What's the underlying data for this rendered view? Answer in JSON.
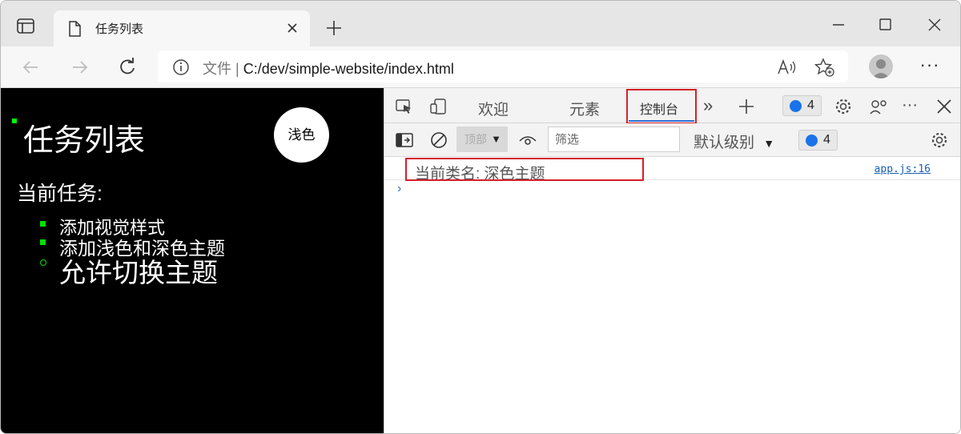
{
  "browser": {
    "tab": {
      "title": "任务列表"
    },
    "address": {
      "info_label": "文件",
      "separator": "|",
      "url": "C:/dev/simple-website/index.html"
    }
  },
  "page": {
    "title": "任务列表",
    "theme_button": "浅色",
    "section_heading": "当前任务:",
    "tasks": [
      "添加视觉样式",
      "添加浅色和深色主题",
      "允许切换主题"
    ]
  },
  "devtools": {
    "tabs": [
      "欢迎",
      "元素",
      "控制台"
    ],
    "active_tab": "控制台",
    "issues_count": "4",
    "filter_placeholder": "筛选",
    "context_label": "顶部",
    "level_label": "默认级别",
    "messages_count": "4",
    "console": {
      "message": "当前类名: 深色主题",
      "source": "app.js:16"
    }
  },
  "colors": {
    "accent": "#2f6fd6",
    "highlight": "#d4202a",
    "page_bg": "#000000",
    "bullet": "#00e000"
  }
}
